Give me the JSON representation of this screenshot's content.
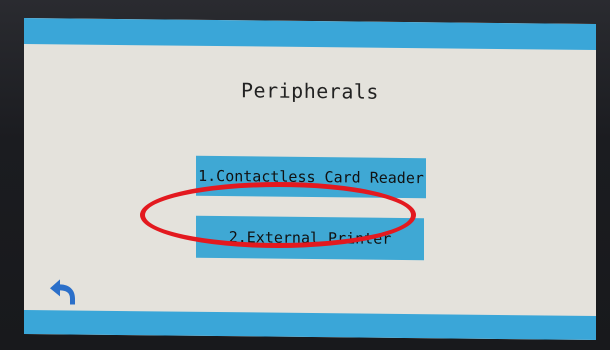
{
  "screen": {
    "title": "Peripherals"
  },
  "menu": {
    "items": [
      {
        "label": "1.Contactless Card Reader"
      },
      {
        "label": "2.External Printer"
      }
    ]
  },
  "icons": {
    "back": "back-arrow-icon"
  },
  "colors": {
    "bar": "#3aa6d8",
    "button": "#3fa8d4",
    "background": "#e4e2dc",
    "highlight": "#e3191f"
  }
}
